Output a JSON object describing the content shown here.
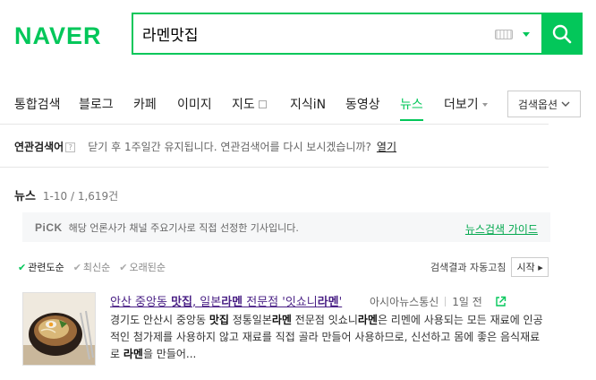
{
  "header": {
    "logo": "NAVER",
    "query": "라멘맛집",
    "colors": {
      "brand": "#03c75a"
    }
  },
  "tabs": [
    {
      "label": "통합검색"
    },
    {
      "label": "블로그"
    },
    {
      "label": "카페"
    },
    {
      "label": "이미지"
    },
    {
      "label": "지도"
    },
    {
      "label": "지식iN"
    },
    {
      "label": "동영상"
    },
    {
      "label": "뉴스"
    },
    {
      "label": "더보기"
    }
  ],
  "active_tab": "뉴스",
  "search_options": "검색옵션",
  "related": {
    "label": "연관검색어",
    "help": "?",
    "message": "닫기 후 1주일간 유지됩니다. 연관검색어를 다시 보시겠습니까?",
    "open": "열기"
  },
  "news": {
    "title": "뉴스",
    "count": "1-10 / 1,619건"
  },
  "pick": {
    "badge": "PiCK",
    "text": "해당 언론사가 채널 주요기사로 직접 선정한 기사입니다.",
    "guide": "뉴스검색 가이드"
  },
  "sort": {
    "relevance": "관련도순",
    "latest": "최신순",
    "oldest": "오래된순"
  },
  "auto_refresh": {
    "label": "검색결과 자동고침",
    "button": "시작"
  },
  "article": {
    "title_parts": [
      "안산 중앙동 ",
      "맛집",
      ", 일본",
      "라멘",
      " 전문점 '잇쇼니",
      "라멘",
      "'"
    ],
    "source": "아시아뉴스통신",
    "time": "1일 전",
    "desc_parts": [
      "경기도 안산시 중앙동 ",
      "맛집",
      " 정통일본",
      "라멘",
      " 전문점 잇쇼니",
      "라멘",
      "은 리멘에 사용되는 모든 재료에 인공적인 첨가제를 사용하지 않고 재료를 직접 골라 만들어 사용하므로, 신선하고 몸에 좋은 음식재료로 ",
      "라멘",
      "을 만들어..."
    ]
  }
}
